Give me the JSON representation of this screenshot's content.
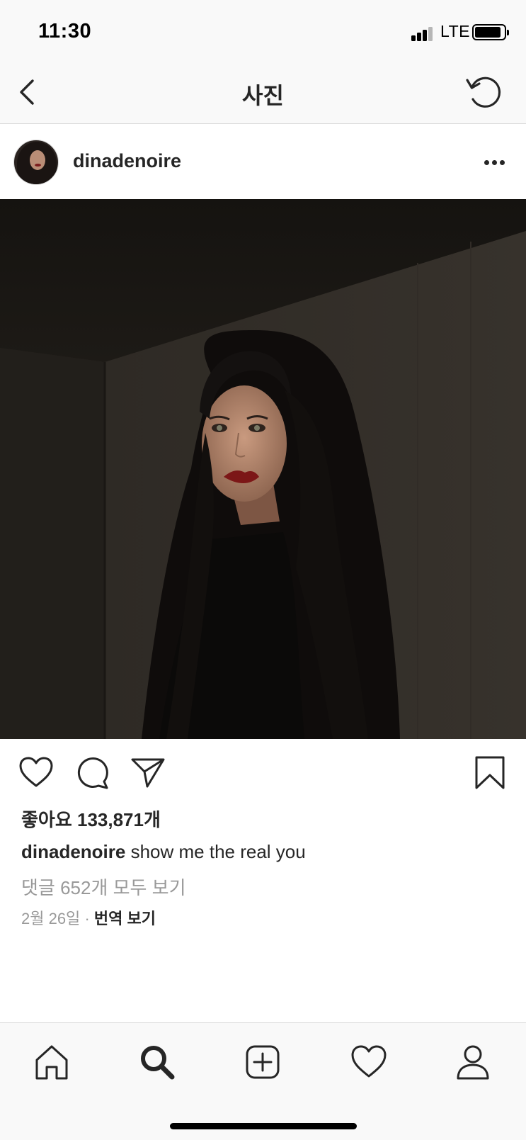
{
  "status_bar": {
    "time": "11:30",
    "network": "LTE"
  },
  "nav": {
    "title": "사진",
    "back_icon": "chevron-left-icon",
    "refresh_icon": "refresh-icon"
  },
  "post": {
    "username": "dinadenoire",
    "likes": "좋아요 133,871개",
    "caption_user": "dinadenoire",
    "caption_text": "show me the real you",
    "view_comments": "댓글 652개 모두 보기",
    "date": "2월 26일",
    "separator": "·",
    "translate": "번역 보기"
  },
  "tab_bar": {
    "items": [
      {
        "icon": "home-icon"
      },
      {
        "icon": "search-icon",
        "active": true
      },
      {
        "icon": "add-post-icon"
      },
      {
        "icon": "activity-heart-icon"
      },
      {
        "icon": "profile-icon"
      }
    ]
  },
  "colors": {
    "text": "#262626",
    "muted": "#999999",
    "bar_bg": "#f9f9f9",
    "divider": "#dbdbdb"
  }
}
